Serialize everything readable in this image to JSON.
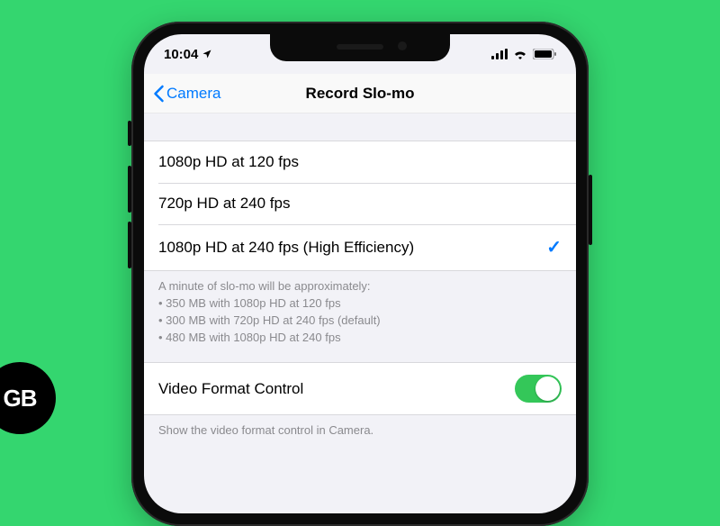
{
  "logo": {
    "text": "GB"
  },
  "statusbar": {
    "time": "10:04"
  },
  "nav": {
    "back_label": "Camera",
    "title": "Record Slo-mo"
  },
  "options": [
    {
      "label": "1080p HD at 120 fps",
      "selected": false
    },
    {
      "label": "720p HD at 240 fps",
      "selected": false
    },
    {
      "label": "1080p HD at 240 fps (High Efficiency)",
      "selected": true
    }
  ],
  "footer": {
    "intro": "A minute of slo-mo will be approximately:",
    "lines": [
      "350 MB with 1080p HD at 120 fps",
      "300 MB with 720p HD at 240 fps (default)",
      "480 MB with 1080p HD at 240 fps"
    ]
  },
  "format_control": {
    "label": "Video Format Control",
    "enabled": true,
    "caption": "Show the video format control in Camera."
  }
}
